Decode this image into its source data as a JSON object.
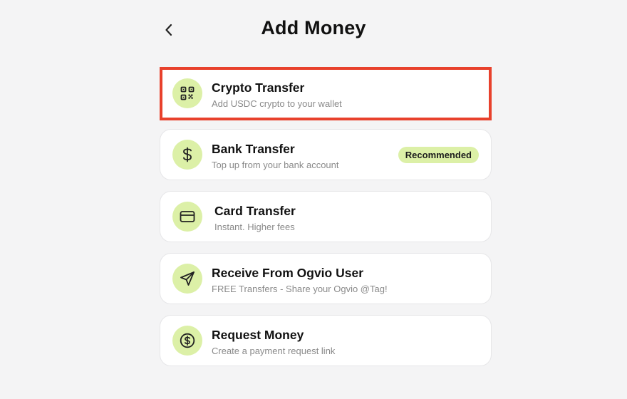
{
  "header": {
    "title": "Add Money",
    "back_icon": "chevron-left-icon"
  },
  "options": [
    {
      "id": "crypto-transfer",
      "title": "Crypto Transfer",
      "subtitle": "Add USDC crypto to your wallet",
      "icon": "qr-code-icon",
      "highlighted": true
    },
    {
      "id": "bank-transfer",
      "title": "Bank Transfer",
      "subtitle": "Top up from your bank account",
      "icon": "dollar-icon",
      "badge": "Recommended"
    },
    {
      "id": "card-transfer",
      "title": "Card Transfer",
      "subtitle": "Instant. Higher fees",
      "icon": "credit-card-icon"
    },
    {
      "id": "receive-from-user",
      "title": "Receive From Ogvio User",
      "subtitle": "FREE Transfers - Share your Ogvio @Tag!",
      "icon": "send-icon"
    },
    {
      "id": "request-money",
      "title": "Request Money",
      "subtitle": "Create a payment request link",
      "icon": "dollar-circle-icon"
    }
  ],
  "colors": {
    "background": "#f4f4f5",
    "accent_green": "#dcf0a7",
    "highlight_red": "#e8412c",
    "card_bg": "#ffffff"
  }
}
